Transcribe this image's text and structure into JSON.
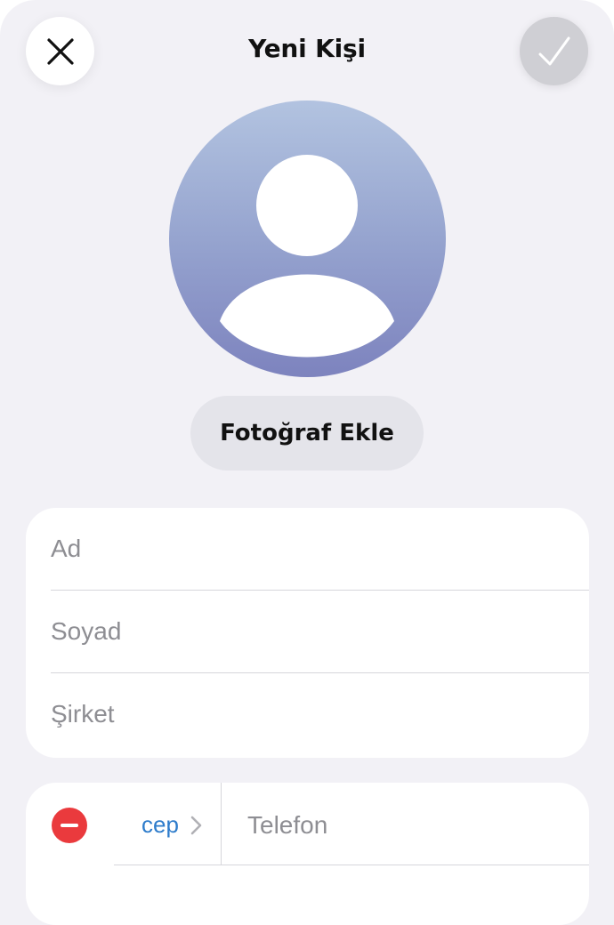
{
  "header": {
    "title": "Yeni Kişi",
    "close_icon": "close-icon",
    "done_icon": "checkmark-icon"
  },
  "photo": {
    "avatar_icon": "person-silhouette-icon",
    "add_photo_label": "Fotoğraf Ekle"
  },
  "name_fields": {
    "first_name_placeholder": "Ad",
    "last_name_placeholder": "Soyad",
    "company_placeholder": "Şirket"
  },
  "phone": {
    "label": "cep",
    "placeholder": "Telefon",
    "remove_icon": "minus-circle-icon",
    "chevron_icon": "chevron-right-icon"
  },
  "colors": {
    "background": "#f2f1f6",
    "card": "#ffffff",
    "accent_blue": "#2e7ccb",
    "destructive_red": "#ea3a3d",
    "placeholder_gray": "#8e8e93"
  }
}
